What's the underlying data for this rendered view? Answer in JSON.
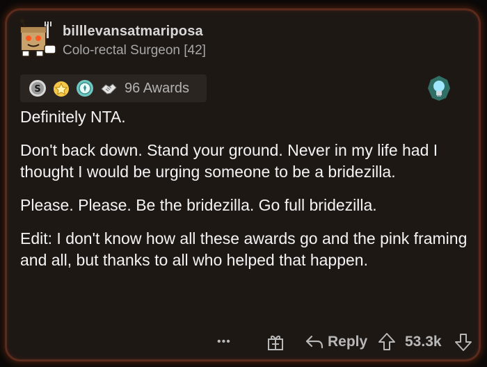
{
  "comment": {
    "username": "billlevansatmariposa",
    "flair": "Colo-rectal Surgeon [42]",
    "awards_count_label": "96 Awards",
    "paragraphs": [
      "Definitely NTA.",
      "Don't back down. Stand your ground. Never in my life had I thought I would be urging someone to be a bridezilla.",
      "Please. Please. Be the bridezilla. Go full bridezilla.",
      "Edit: I don't know how all these awards go and the pink framing and all, but thanks to all who helped that happen."
    ]
  },
  "actions": {
    "more_label": "•••",
    "reply_label": "Reply",
    "score": "53.3k"
  },
  "icons": {
    "awards": [
      "silver-award-icon",
      "gold-award-icon",
      "platinum-award-icon",
      "handshake-award-icon"
    ],
    "actions": [
      "more-icon",
      "gift-award-icon",
      "reply-arrow-icon",
      "upvote-icon",
      "downvote-icon"
    ],
    "flair_badge": "lightbulb-icon"
  },
  "colors": {
    "card_background": "#1e1815",
    "card_border_glow": "#5a2a1c",
    "text_primary": "#f4f4f4",
    "text_secondary": "#a7a7a7"
  }
}
